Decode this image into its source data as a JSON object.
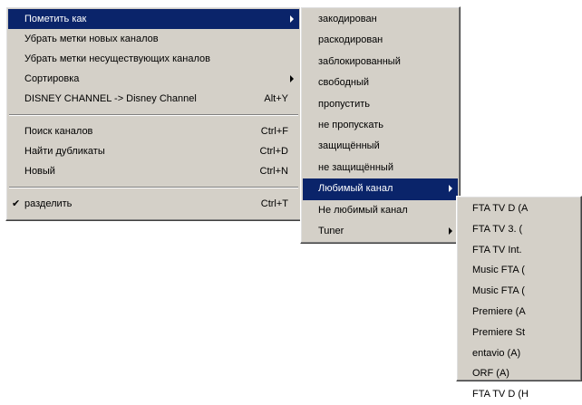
{
  "main_menu": {
    "items": [
      {
        "label": "Пометить как",
        "accel": ""
      },
      {
        "label": "Убрать метки новых каналов",
        "accel": ""
      },
      {
        "label": "Убрать метки несуществующих каналов",
        "accel": ""
      },
      {
        "label": "Сортировка",
        "accel": ""
      },
      {
        "label": "DISNEY CHANNEL -> Disney Channel",
        "accel": "Alt+Y"
      },
      {
        "label": "Поиск каналов",
        "accel": "Ctrl+F"
      },
      {
        "label": "Найти дубликаты",
        "accel": "Ctrl+D"
      },
      {
        "label": "Новый",
        "accel": "Ctrl+N"
      },
      {
        "label": "разделить",
        "accel": "Ctrl+T",
        "check": "✔"
      }
    ]
  },
  "mark_menu": {
    "items": [
      "закодирован",
      "раскодирован",
      "заблокированный",
      "свободный",
      "пропустить",
      "не пропускать",
      "защищённый",
      "не защищённый",
      "Любимый канал",
      "Не любимый канал",
      "Tuner"
    ]
  },
  "favorite_menu": {
    "items": [
      "FTA TV D (A",
      "FTA TV 3. (",
      "FTA TV Int.",
      "Music FTA (",
      "Music FTA (",
      "Premiere (A",
      "Premiere St",
      "entavio (A)",
      "ORF (A)",
      "FTA TV D (H"
    ]
  }
}
